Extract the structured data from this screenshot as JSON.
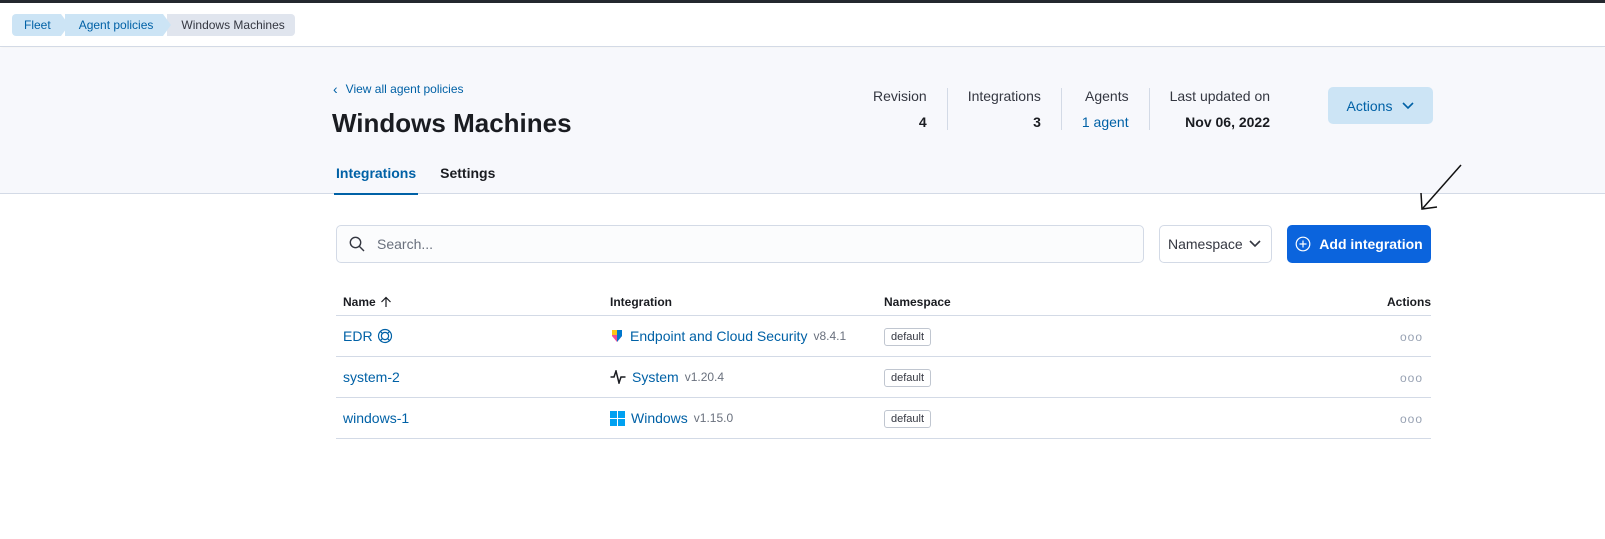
{
  "breadcrumbs": [
    {
      "label": "Fleet"
    },
    {
      "label": "Agent policies"
    },
    {
      "label": "Windows Machines"
    }
  ],
  "header": {
    "back_link": "View all agent policies",
    "title": "Windows Machines",
    "actions_label": "Actions"
  },
  "stats": [
    {
      "label": "Revision",
      "value": "4"
    },
    {
      "label": "Integrations",
      "value": "3"
    },
    {
      "label": "Agents",
      "value": "1 agent"
    },
    {
      "label": "Last updated on",
      "value": "Nov 06, 2022"
    }
  ],
  "tabs": [
    {
      "label": "Integrations",
      "active": true
    },
    {
      "label": "Settings",
      "active": false
    }
  ],
  "toolbar": {
    "search_placeholder": "Search...",
    "namespace_label": "Namespace",
    "add_label": "Add integration"
  },
  "table": {
    "headers": {
      "name": "Name",
      "integration": "Integration",
      "namespace": "Namespace",
      "actions": "Actions"
    },
    "rows": [
      {
        "name": "EDR",
        "integration": "Endpoint and Cloud Security",
        "version": "v8.4.1",
        "namespace": "default",
        "icon": "elastic-security-icon"
      },
      {
        "name": "system-2",
        "integration": "System",
        "version": "v1.20.4",
        "namespace": "default",
        "icon": "system-pulse-icon"
      },
      {
        "name": "windows-1",
        "integration": "Windows",
        "version": "v1.15.0",
        "namespace": "default",
        "icon": "windows-logo-icon"
      }
    ]
  },
  "colors": {
    "primary": "#0b64dd",
    "link": "#0061a6",
    "accent_bg": "#cce4f5"
  }
}
